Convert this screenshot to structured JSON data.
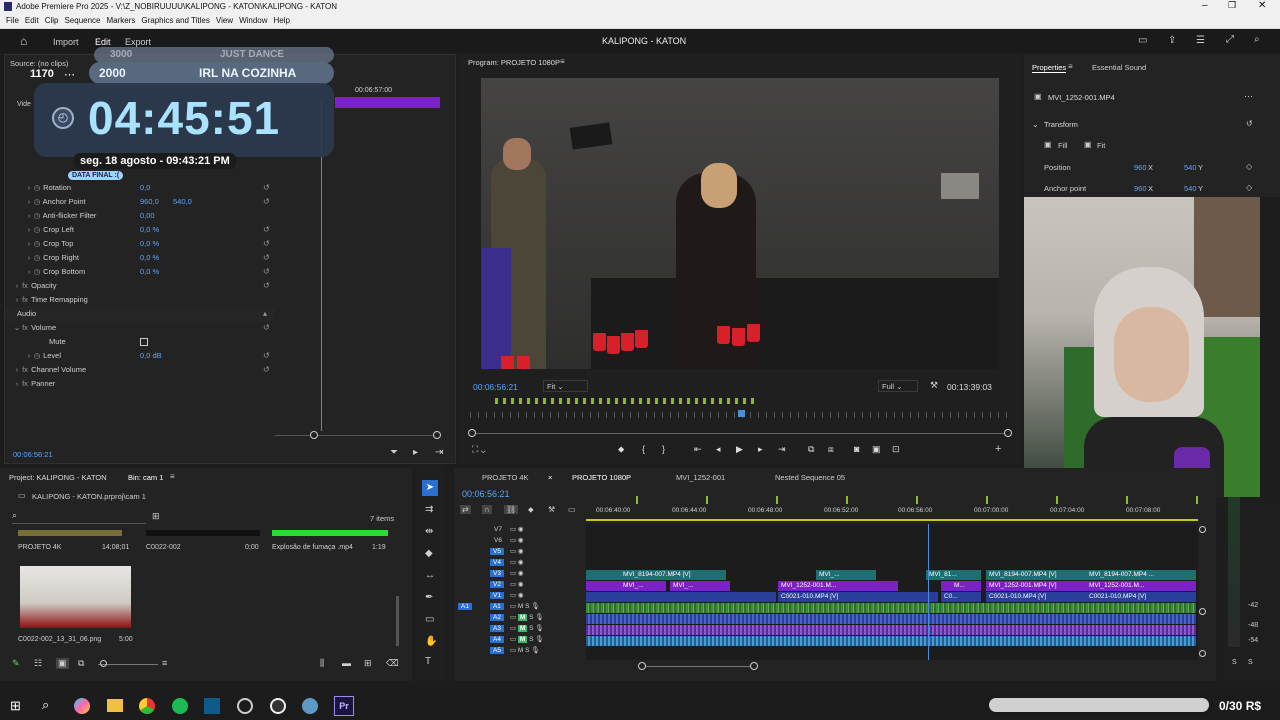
{
  "window": {
    "title": "Adobe Premiere Pro 2025 - V:\\Z_NOBIRUUUU\\KALIPONG - KATON\\KALIPONG - KATON"
  },
  "menu": [
    "File",
    "Edit",
    "Clip",
    "Sequence",
    "Markers",
    "Graphics and Titles",
    "View",
    "Window",
    "Help"
  ],
  "appbar": {
    "import": "Import",
    "edit": "Edit",
    "export": "Export",
    "project_title": "KALIPONG - KATON"
  },
  "source": {
    "label": "Source: (no clips)",
    "time_marker": "00:06:57:00",
    "tab_short": "Vide",
    "current_time": "00:06:56:21"
  },
  "effect_controls": {
    "rows": [
      {
        "name": "Rotation",
        "v1": "0,0"
      },
      {
        "name": "Anchor Point",
        "v1": "960,0",
        "v2": "540,0"
      },
      {
        "name": "Anti-flicker Filter",
        "v1": "0,00"
      },
      {
        "name": "Crop Left",
        "v1": "0,0 %"
      },
      {
        "name": "Crop Top",
        "v1": "0,0 %"
      },
      {
        "name": "Crop Right",
        "v1": "0,0 %"
      },
      {
        "name": "Crop Bottom",
        "v1": "0,0 %"
      }
    ],
    "opacity": "Opacity",
    "time_remap": "Time Remapping",
    "audio": "Audio",
    "volume": "Volume",
    "mute": "Mute",
    "level": "Level",
    "level_val": "0,0 dB",
    "channel_volume": "Channel Volume",
    "panner": "Panner"
  },
  "overlay": {
    "n1": "3000",
    "n1_label": "JUST DANCE",
    "n_left": "1170",
    "n2": "2000",
    "n2_label": "IRL NA COZINHA",
    "timer": "04:45:51",
    "date": "seg. 18 agosto - 09:43:21 PM",
    "final": "DATA FINAL :("
  },
  "program": {
    "label": "Program: PROJETO 1080P",
    "timecode": "00:06:56:21",
    "fit": "Fit",
    "quality": "Full",
    "duration": "00:13:39:03"
  },
  "properties": {
    "tab1": "Properties",
    "tab2": "Essential Sound",
    "clip": "MVI_1252-001.MP4",
    "transform": "Transform",
    "fill": "Fill",
    "fit": "Fit",
    "position": "Position",
    "pos_x": "960",
    "pos_y": "540",
    "anchor": "Anchor point",
    "anc_x": "960",
    "anc_y": "540",
    "x": "X",
    "y": "Y"
  },
  "project": {
    "tab": "Project: KALIPONG - KATON",
    "bin": "Bin: cam 1",
    "file": "KALIPONG - KATON.prproj\\cam 1",
    "items": "7 items",
    "media": [
      {
        "name": "PROJETO 4K",
        "dur": "14;08;01"
      },
      {
        "name": "C0022-002",
        "dur": "0;00"
      },
      {
        "name": "Explosão de fumaça .mp4",
        "dur": "1:19"
      }
    ],
    "thumb": {
      "name": "C0022-002_13_31_06.png",
      "dur": "5:00"
    }
  },
  "timeline": {
    "tabs": [
      "PROJETO 4K",
      "PROJETO 1080P",
      "MVI_1252-001",
      "Nested Sequence 05"
    ],
    "timecode": "00:06:56:21",
    "ruler": [
      "00:06:40:00",
      "00:06:44:00",
      "00:06:48:00",
      "00:06:52:00",
      "00:06:56:00",
      "00:07:00:00",
      "00:07:04:00",
      "00:07:08:00"
    ],
    "video_tracks": [
      "V7",
      "V6",
      "V5",
      "V4",
      "V3",
      "V2",
      "V1"
    ],
    "audio_tracks": [
      "A1",
      "A2",
      "A3",
      "A4",
      "A5"
    ],
    "clips_v3": [
      "MVI_8194-007.MP4 [V]",
      "MVI_...",
      "MVI_81...",
      "MVI_8194-007.MP4 [V]",
      "MVI_8194-007.MP4 ..."
    ],
    "clips_v2": [
      "MVI_...",
      "MVI_...",
      "MVI_1252-001.M...",
      "M...",
      "MVI_1252-001.MP4 [V]",
      "MVI_1252-001.M..."
    ],
    "clips_v1": [
      "C0021-010.MP4 [V]",
      "C0...",
      "C0021-010.MP4 [V]",
      "C0021-010.MP4 [V]"
    ]
  },
  "meter": {
    "ticks": [
      "-42",
      "-48",
      "-54"
    ],
    "s": "S"
  },
  "taskbar": {
    "donation": "0/30 R$"
  }
}
